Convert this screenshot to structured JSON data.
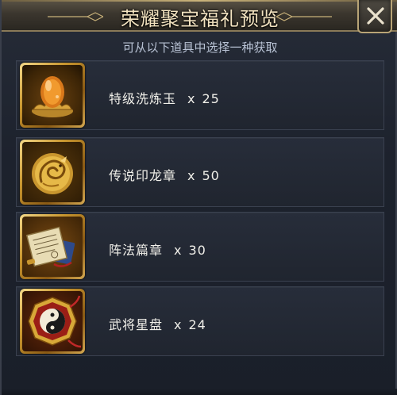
{
  "header": {
    "title": "荣耀聚宝福礼预览"
  },
  "subtitle": "可从以下道具中选择一种获取",
  "items": [
    {
      "name": "特级洗炼玉",
      "x": "x",
      "qty": "25",
      "icon": "amber-jade-icon"
    },
    {
      "name": "传说印龙章",
      "x": "x",
      "qty": "50",
      "icon": "dragon-seal-icon"
    },
    {
      "name": "阵法篇章",
      "x": "x",
      "qty": "30",
      "icon": "scroll-book-icon"
    },
    {
      "name": "武将星盘",
      "x": "x",
      "qty": "24",
      "icon": "yin-yang-plate-icon"
    }
  ],
  "colors": {
    "header_gold": "#c9b27a",
    "frame_gold": "#d4a850",
    "panel_bg": "#1d222d",
    "subtitle_text": "#b8c2d4"
  }
}
